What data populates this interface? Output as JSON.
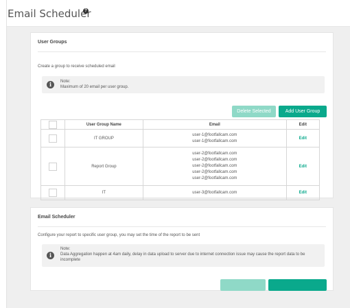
{
  "header": {
    "title": "Email Scheduler"
  },
  "user_groups": {
    "title": "User Groups",
    "description": "Create a group to receive scheduled email",
    "note_label": "Note:",
    "note_text": "Maximum of 20 email per user group.",
    "delete_selected_label": "Delete Selected",
    "add_group_label": "Add User Group",
    "columns": [
      "",
      "User Group Name",
      "Email",
      "Edit"
    ],
    "rows": [
      {
        "name": "IT GROUP",
        "emails": [
          "user-1@footfallcam.com",
          "user-1@footfallcam.com"
        ],
        "edit": "Edit"
      },
      {
        "name": "Report Group",
        "emails": [
          "user-2@footfallcam.com",
          "user-2@footfallcam.com",
          "user-2@footfallcam.com",
          "user-2@footfallcam.com",
          "user-2@footfallcam.com"
        ],
        "edit": "Edit"
      },
      {
        "name": "IT",
        "emails": [
          "user-3@footfallcam.com"
        ],
        "edit": "Edit"
      }
    ]
  },
  "email_scheduler": {
    "title": "Email Scheduler",
    "description": "Configure your report to specific user group, you may set the time of the report to be sent",
    "note_label": "Note:",
    "note_text": "Data Aggregation happen at 4am daily, delay in data upload to server due to internet connection issue may cause the report data to be incomplete"
  },
  "colors": {
    "accent": "#0aa98c",
    "accent_disabled": "#8fd9c7",
    "background": "#efefef"
  }
}
